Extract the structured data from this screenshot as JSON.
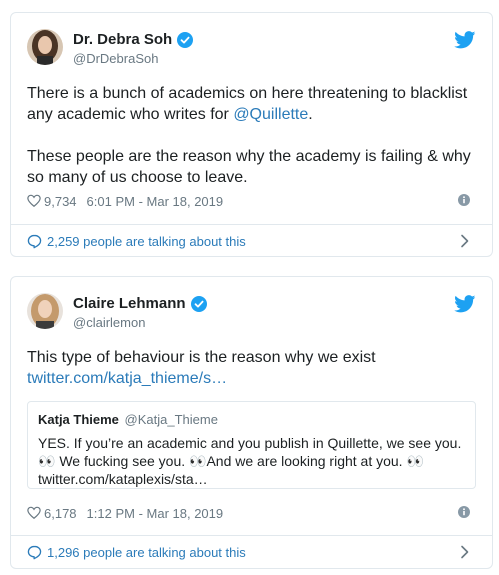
{
  "tweets": [
    {
      "author_name": "Dr. Debra Soh",
      "author_handle": "@DrDebraSoh",
      "text_before_mention": "There is a bunch of academics on here threatening to blacklist any academic who writes for ",
      "mention": "@Quillette",
      "text_after_mention": ".\n\nThese people are the reason why the academy is failing & why so many of us choose to leave.",
      "likes": "9,734",
      "timestamp": "6:01 PM - Mar 18, 2019",
      "talking": "2,259 people are talking about this"
    },
    {
      "author_name": "Claire Lehmann",
      "author_handle": "@clairlemon",
      "text": "This type of behaviour is the reason why we exist",
      "link": "twitter.com/katja_thieme/s…",
      "quoted": {
        "author_name": "Katja Thieme",
        "author_handle": "@Katja_Thieme",
        "text": "YES. If you’re an academic and you publish in Quillette, we see you. 👀 We fucking see you. 👀And we are looking right at you. 👀\ntwitter.com/kataplexis/sta…"
      },
      "likes": "6,178",
      "timestamp": "1:12 PM - Mar 18, 2019",
      "talking": "1,296 people are talking about this"
    }
  ],
  "colors": {
    "link": "#2b7bb9",
    "twitter_blue": "#1da1f2",
    "border": "#e1e8ed",
    "muted": "#697882"
  },
  "icons": [
    "avatar",
    "verified-badge-icon",
    "twitter-bird-icon",
    "heart-icon",
    "info-icon",
    "speech-bubble-icon",
    "chevron-right-icon"
  ]
}
